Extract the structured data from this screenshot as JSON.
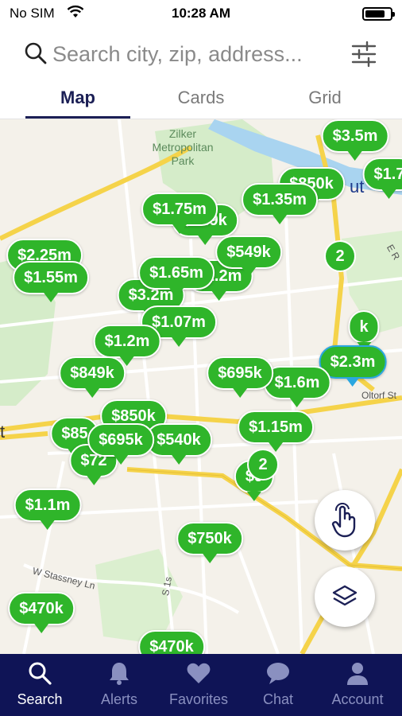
{
  "status_bar": {
    "carrier": "No SIM",
    "time": "10:28 AM",
    "battery_level": 0.8
  },
  "search": {
    "placeholder": "Search city, zip, address..."
  },
  "tabs": [
    {
      "label": "Map",
      "active": true
    },
    {
      "label": "Cards",
      "active": false
    },
    {
      "label": "Grid",
      "active": false
    }
  ],
  "map": {
    "park_label": "Zilker\nMetropolitan\nPark",
    "street_labels": [
      "W Stassney Ln",
      "Oltorf St",
      "E R",
      "S 1s",
      "ut",
      "t"
    ],
    "price_pins": [
      "$3.5m",
      "$1.7",
      "$1.35m",
      "$1.75m",
      "$2.25m",
      "$1.55m",
      "$549k",
      "$1.65m",
      "$3.2m",
      "$1.07m",
      "$1.2m",
      "$1.2m",
      "$2.3m",
      "$849k",
      "$695k",
      "$1.6m",
      "$850k",
      "$85",
      "$695k",
      "$540k",
      "$1.15m",
      "$72",
      "$9",
      "$1.1m",
      "$750k",
      "$850k",
      "$849k",
      "$470k",
      "k"
    ],
    "selected_pin": "$2.3m",
    "clusters": [
      "2",
      "2"
    ],
    "colors": {
      "pin": "#2fb52a",
      "selected_outline": "#2aa7e0",
      "park": "#d5ecc9",
      "water": "#a9d4f0",
      "major_road": "#f5d34a"
    }
  },
  "fab": {
    "tap_icon": "hand-tap-icon",
    "layers_icon": "layers-icon"
  },
  "bottom_nav": [
    {
      "label": "Search",
      "icon": "search-icon",
      "active": true
    },
    {
      "label": "Alerts",
      "icon": "bell-icon",
      "active": false
    },
    {
      "label": "Favorites",
      "icon": "heart-icon",
      "active": false
    },
    {
      "label": "Chat",
      "icon": "chat-bubble-icon",
      "active": false
    },
    {
      "label": "Account",
      "icon": "user-icon",
      "active": false
    }
  ],
  "brand_colors": {
    "nav_background": "#0f1456",
    "tab_active": "#1b1f55"
  }
}
